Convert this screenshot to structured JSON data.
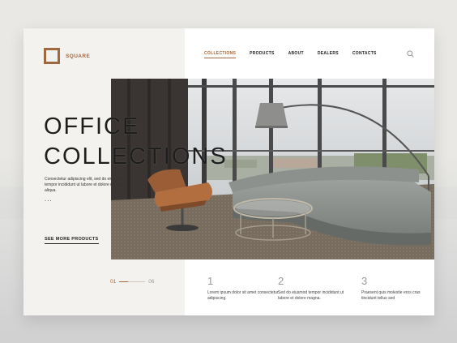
{
  "brand": {
    "name": "SQUARE",
    "accent_color": "#a0683e"
  },
  "nav": {
    "items": [
      {
        "label": "COLLECTIONS",
        "active": true
      },
      {
        "label": "PRODUCTS",
        "active": false
      },
      {
        "label": "ABOUT",
        "active": false
      },
      {
        "label": "DEALERS",
        "active": false
      },
      {
        "label": "CONTACTS",
        "active": false
      }
    ],
    "search_icon": "search-icon"
  },
  "hero": {
    "title_line1": "OFFICE",
    "title_line2": "COLLECTIONS",
    "subtitle": "Consectetur adipiscing elit, sed do eiusmod tempor incididunt ut labore et dolore magna aliqua.",
    "dots": "...",
    "cta": "SEE MORE PRODUCTS"
  },
  "pager": {
    "current": "01",
    "total": "06"
  },
  "features": [
    {
      "number": "1",
      "text": "Lorem ipsum dolor sit amet consectetur adipiscing."
    },
    {
      "number": "2",
      "text": "Sed do eiusmod tempor incididunt ut labore et dolore magna."
    },
    {
      "number": "3",
      "text": "Praesent quis molestie eros cras tincidunt tellus sed"
    }
  ]
}
